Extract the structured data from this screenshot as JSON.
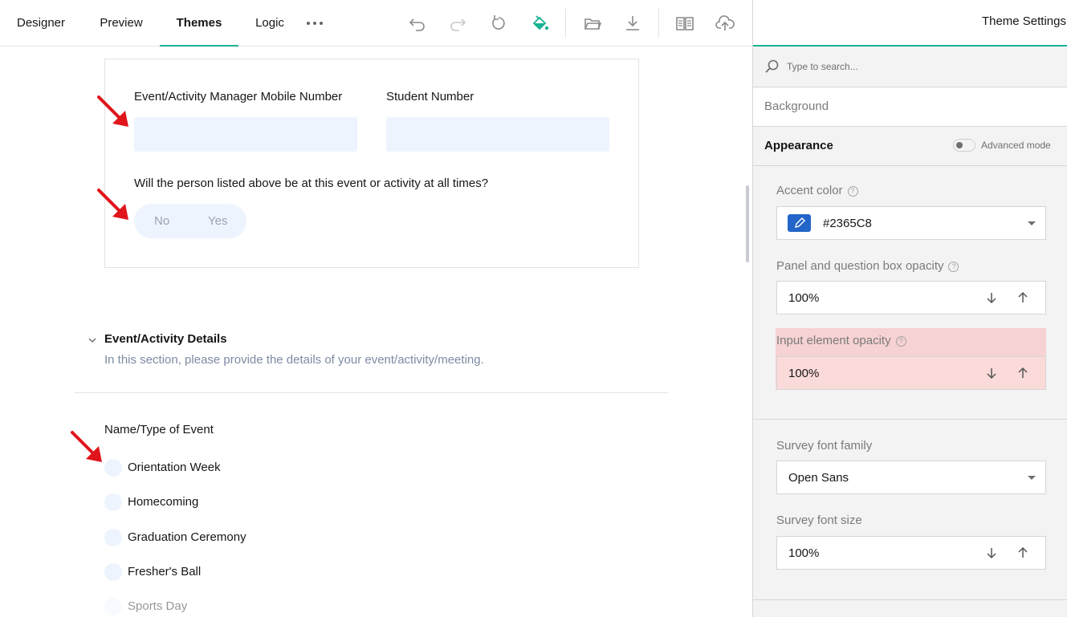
{
  "tabs": [
    {
      "label": "Designer"
    },
    {
      "label": "Preview"
    },
    {
      "label": "Themes",
      "active": true
    },
    {
      "label": "Logic"
    }
  ],
  "toolbar_icons": [
    "undo-icon",
    "redo-icon",
    "reset-icon",
    "paint-bucket-icon",
    "open-folder-icon",
    "download-icon",
    "book-icon",
    "cloud-upload-icon"
  ],
  "survey": {
    "panel": {
      "q1_title": "Event/Activity Manager Mobile Number",
      "q2_title": "Student Number",
      "q3_title": "Will the person listed above be at this event or activity at all times?",
      "q3_options": {
        "no": "No",
        "yes": "Yes"
      }
    },
    "section": {
      "title": "Event/Activity Details",
      "description": "In this section, please provide the details of your event/activity/meeting."
    },
    "question": {
      "title": "Name/Type of Event",
      "choices": [
        "Orientation Week",
        "Homecoming",
        "Graduation Ceremony",
        "Fresher's Ball",
        "Sports Day"
      ]
    }
  },
  "sidebar": {
    "header_title": "Theme Settings",
    "search_placeholder": "Type to search...",
    "category_background": "Background",
    "category_appearance": "Appearance",
    "advanced_mode_label": "Advanced mode",
    "accent_color_label": "Accent color",
    "accent_color_value": "#2365C8",
    "accent_color_hex": "#2365C8",
    "panel_opacity_label": "Panel and question box opacity",
    "panel_opacity_value": "100%",
    "input_opacity_label": "Input element opacity",
    "input_opacity_value": "100%",
    "font_family_label": "Survey font family",
    "font_family_value": "Open Sans",
    "font_size_label": "Survey font size",
    "font_size_value": "100%"
  },
  "colors": {
    "accent_green": "#19b394",
    "input_bg": "#eef4fe",
    "annotation_red": "#e0141b",
    "highlight_bg": "#f6d2d2"
  }
}
